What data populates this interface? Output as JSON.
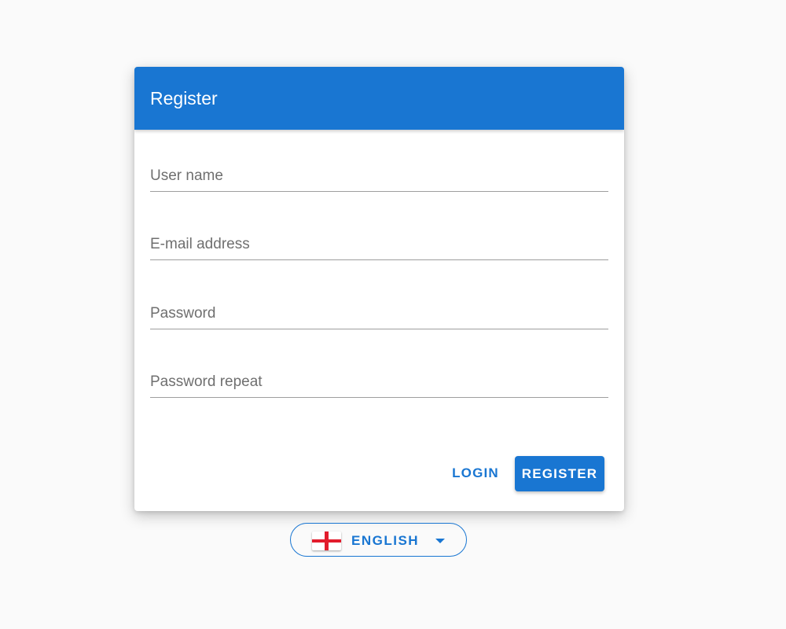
{
  "register_card": {
    "title": "Register",
    "fields": {
      "username_placeholder": "User name",
      "email_placeholder": "E-mail address",
      "password_placeholder": "Password",
      "password_repeat_placeholder": "Password repeat"
    },
    "login_label": "LOGIN",
    "register_label": "REGISTER"
  },
  "language": {
    "label": "ENGLISH",
    "flag_icon": "england-flag-icon",
    "dropdown_icon": "arrow-drop-down-icon"
  },
  "colors": {
    "primary": "#1976d2",
    "background": "#fafafa",
    "flag_red": "#e21c2c"
  }
}
